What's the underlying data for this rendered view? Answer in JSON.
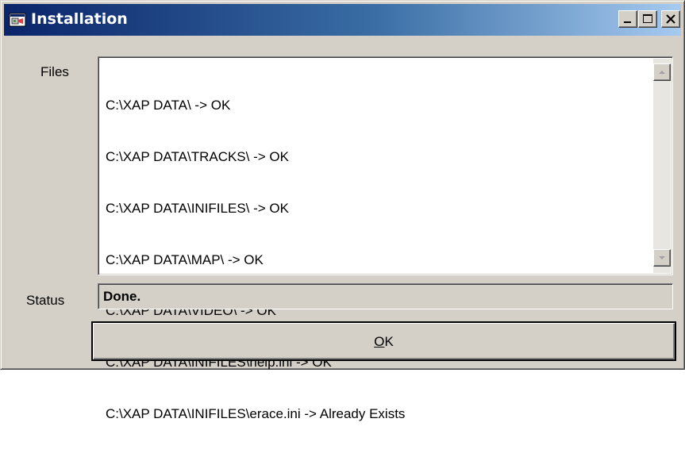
{
  "window": {
    "title": "Installation",
    "title_icon": "installer-app-icon",
    "controls": [
      "minimize-icon",
      "maximize-icon",
      "close-icon"
    ]
  },
  "files": {
    "label": "Files",
    "lines": [
      "C:\\XAP DATA\\ -> OK",
      "C:\\XAP DATA\\TRACKS\\ -> OK",
      "C:\\XAP DATA\\INIFILES\\ -> OK",
      "C:\\XAP DATA\\MAP\\ -> OK",
      "C:\\XAP DATA\\VIDEO\\ -> OK",
      "C:\\XAP DATA\\INIFILES\\help.ini -> OK",
      "C:\\XAP DATA\\INIFILES\\erace.ini -> Already Exists"
    ]
  },
  "status": {
    "label": "Status",
    "value": "Done."
  },
  "ok_button": {
    "mnemonic": "O",
    "rest": "K"
  },
  "colors": {
    "face": "#d4d0c8",
    "title_start": "#0a246a",
    "title_end": "#a6caf0"
  }
}
